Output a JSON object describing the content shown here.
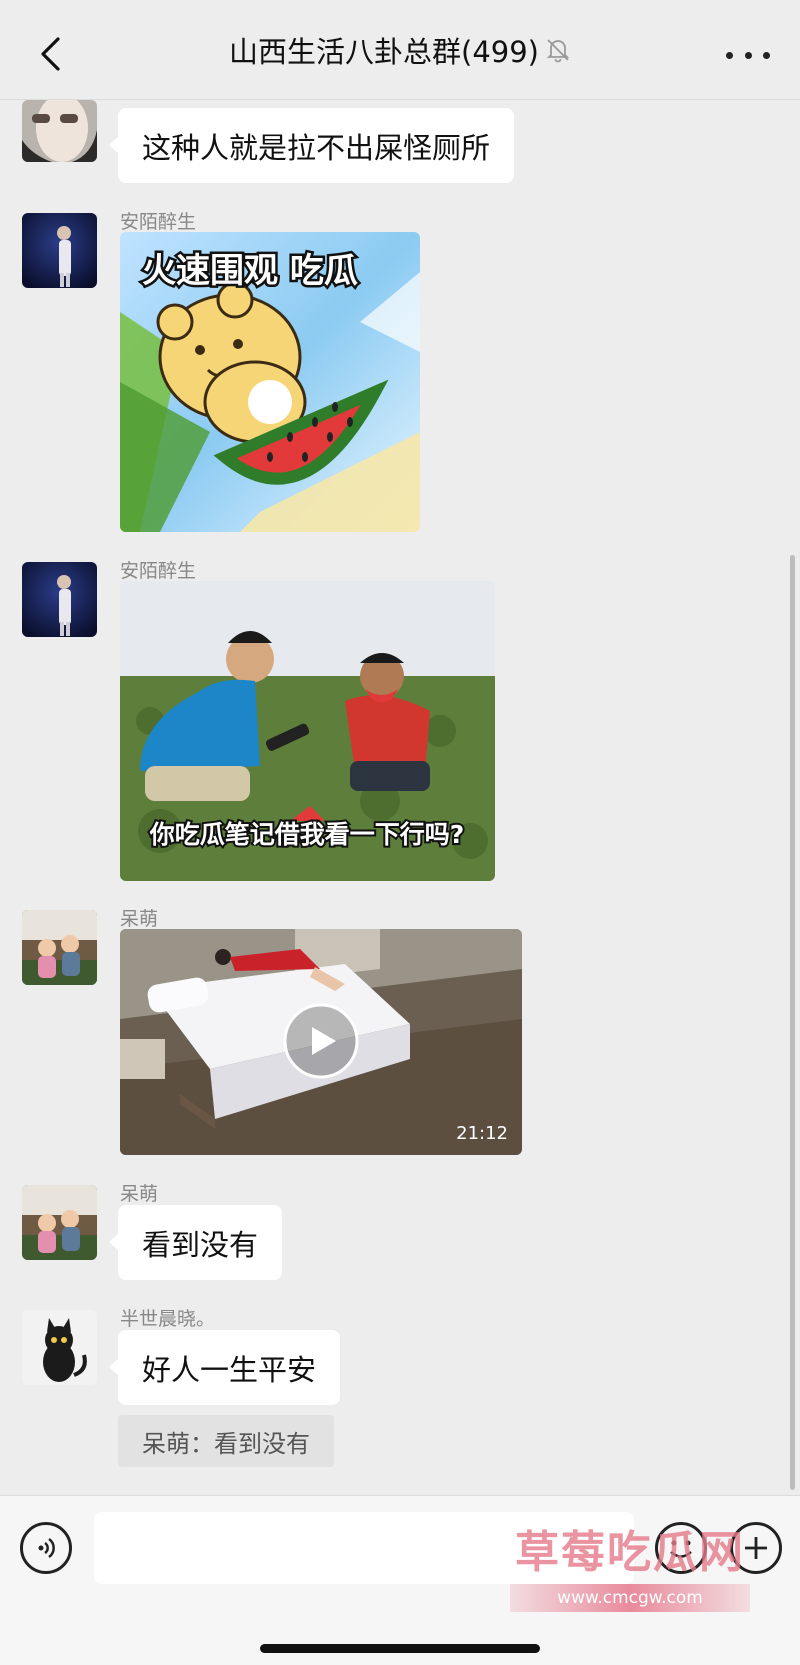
{
  "header": {
    "title": "山西生活八卦总群(499)"
  },
  "messages": [
    {
      "text": "这种人就是拉不出屎怪厕所"
    },
    {
      "sender": "安陌醉生",
      "sticker_text": "火速围观 吃瓜"
    },
    {
      "sender": "安陌醉生",
      "meme_caption": "你吃瓜笔记借我看一下行吗?"
    },
    {
      "sender": "呆萌",
      "video_duration": "21:12"
    },
    {
      "sender": "呆萌",
      "text": "看到没有"
    },
    {
      "sender": "半世晨晓。",
      "text": "好人一生平安",
      "quote": "呆萌：看到没有"
    }
  ],
  "watermark": {
    "title": "草莓吃瓜网",
    "url": "www.cmcgw.com"
  },
  "colors": {
    "background": "#ededed",
    "bubble": "#ffffff",
    "quote_bg": "#e2e2e2",
    "watermark": "#e57a8a"
  },
  "icons": [
    "back-arrow-icon",
    "mute-bell-icon",
    "more-dots-icon",
    "voice-icon",
    "emoji-icon",
    "plus-icon",
    "play-icon"
  ]
}
